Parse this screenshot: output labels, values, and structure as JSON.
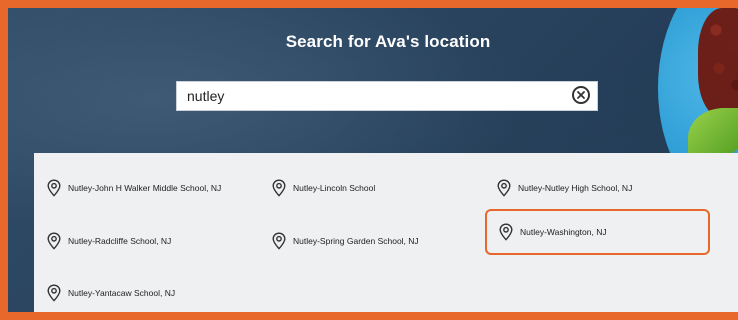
{
  "page": {
    "title": "Search for Ava's location"
  },
  "search": {
    "value": "nutley",
    "clear_icon": "close-circle-icon"
  },
  "results": [
    {
      "label": "Nutley-John H Walker Middle School, NJ",
      "icon": "map-pin-icon"
    },
    {
      "label": "Nutley-Lincoln School",
      "icon": "map-pin-icon"
    },
    {
      "label": "Nutley-Nutley High School, NJ",
      "icon": "map-pin-icon"
    },
    {
      "label": "Nutley-Radcliffe School, NJ",
      "icon": "map-pin-icon"
    },
    {
      "label": "Nutley-Spring Garden School, NJ",
      "icon": "map-pin-icon"
    },
    {
      "label": "Nutley-Washington, NJ",
      "icon": "map-pin-icon",
      "selected": true
    },
    {
      "label": "Nutley-Yantacaw School, NJ",
      "icon": "map-pin-icon"
    }
  ],
  "colors": {
    "accent": "#e8672a",
    "background": "#2a445f",
    "results_panel": "#eef0f2"
  }
}
